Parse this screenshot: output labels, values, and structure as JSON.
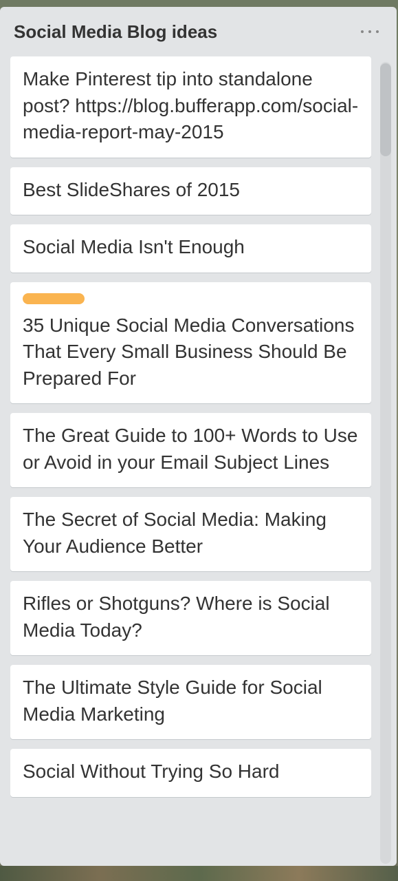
{
  "list": {
    "title": "Social Media Blog ideas",
    "menu_icon": "ellipsis-icon",
    "cards": [
      {
        "text": "Make Pinterest tip into standalone post? https://blog.bufferapp.com/social-media-report-may-2015",
        "label": null
      },
      {
        "text": "Best SlideShares of 2015",
        "label": null
      },
      {
        "text": "Social Media Isn't Enough",
        "label": null
      },
      {
        "text": "35 Unique Social Media Conversations That Every Small Business Should Be Prepared For",
        "label": "#fab450"
      },
      {
        "text": "The Great Guide to 100+ Words to Use or Avoid in your Email Subject Lines",
        "label": null
      },
      {
        "text": "The Secret of Social Media: Making Your Audience Better",
        "label": null
      },
      {
        "text": "Rifles or Shotguns? Where is Social Media Today?",
        "label": null
      },
      {
        "text": "The Ultimate Style Guide for Social Media Marketing",
        "label": null
      },
      {
        "text": "Social Without Trying So Hard",
        "label": null
      }
    ]
  },
  "colors": {
    "list_bg": "#e2e4e6",
    "card_bg": "#ffffff",
    "label_orange": "#fab450",
    "text": "#333333"
  }
}
